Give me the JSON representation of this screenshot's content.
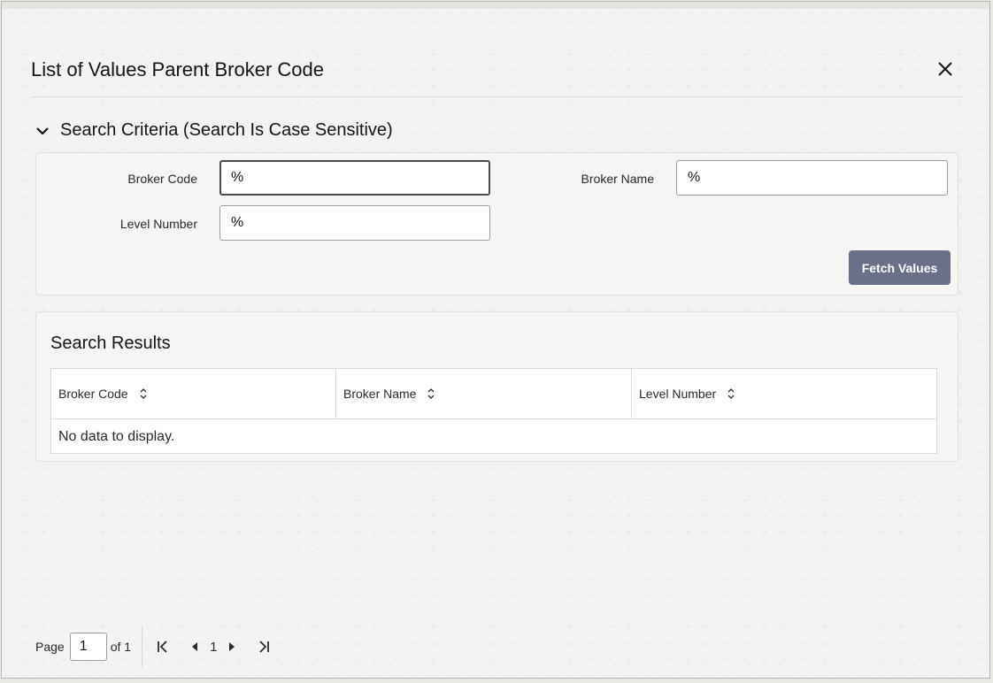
{
  "dialog": {
    "title": "List of Values Parent Broker Code",
    "close_icon": "close-icon"
  },
  "search_criteria": {
    "heading": "Search Criteria (Search Is Case Sensitive)",
    "broker_code_label": "Broker Code",
    "broker_code_value": "%",
    "broker_name_label": "Broker Name",
    "broker_name_value": "%",
    "level_number_label": "Level Number",
    "level_number_value": "%",
    "fetch_button": "Fetch Values"
  },
  "search_results": {
    "heading": "Search Results",
    "columns": [
      "Broker Code",
      "Broker Name",
      "Level Number"
    ],
    "empty_message": "No data to display."
  },
  "pagination": {
    "page_label": "Page",
    "current_page": "1",
    "of_label": "of 1",
    "page_number": "1"
  },
  "colors": {
    "fetch_button": "#6b7089",
    "panel_bg": "#f6f5f3"
  }
}
